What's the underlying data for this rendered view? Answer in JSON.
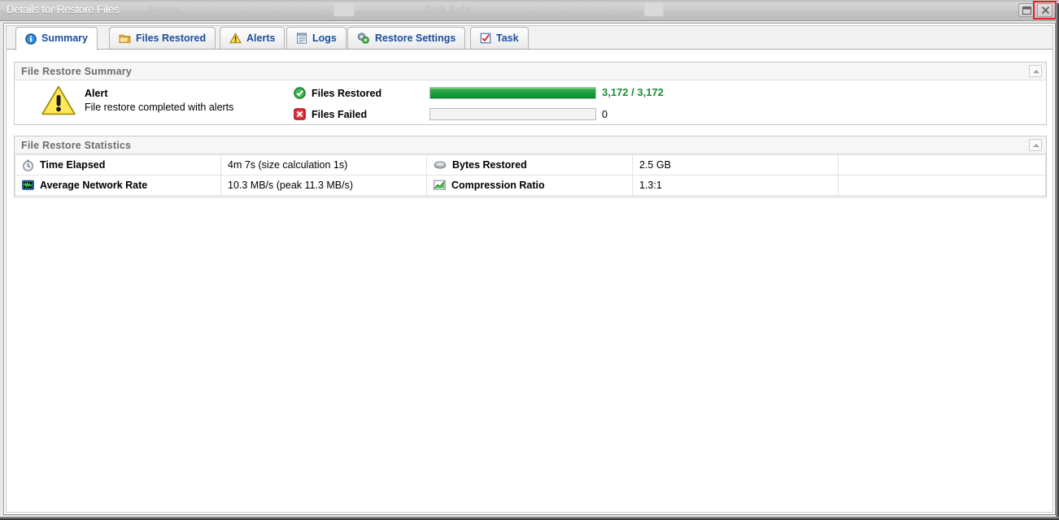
{
  "window": {
    "title": "Details for Restore Files",
    "background_text_1": "Server",
    "background_text_2": "Development Server Windows 2008",
    "background_text_3": "Disk Safe",
    "background_text_4": "Development Server Windows 2008",
    "restore_button_label": "",
    "close_button_label": "×",
    "highlight_color": "#ee1c25"
  },
  "tabs": [
    {
      "label": "Summary",
      "icon": "info-icon",
      "active": true
    },
    {
      "label": "Files Restored",
      "icon": "folder-icon",
      "active": false
    },
    {
      "label": "Alerts",
      "icon": "warning-triangle-icon",
      "active": false
    },
    {
      "label": "Logs",
      "icon": "document-lines-icon",
      "active": false
    },
    {
      "label": "Restore Settings",
      "icon": "gears-icon",
      "active": false
    },
    {
      "label": "Task",
      "icon": "checkbox-task-icon",
      "active": false
    }
  ],
  "summary_panel": {
    "title": "File Restore Summary",
    "collapse_icon": "chevron-up-icon",
    "alert": {
      "icon": "warning-triangle-icon",
      "title": "Alert",
      "message": "File restore completed with alerts"
    },
    "rows": [
      {
        "icon": "green-check-icon",
        "label": "Files Restored",
        "value": "3,172 / 3,172",
        "progress_percent": 100,
        "value_color": "#1e8c35"
      },
      {
        "icon": "red-x-icon",
        "label": "Files Failed",
        "value": "0",
        "progress_percent": 0,
        "value_color": "#000000"
      }
    ]
  },
  "statistics_panel": {
    "title": "File Restore Statistics",
    "collapse_icon": "chevron-up-icon",
    "rows": [
      {
        "left_icon": "stopwatch-icon",
        "left_label": "Time Elapsed",
        "left_value": "4m 7s (size calculation 1s)",
        "right_icon": "disk-icon",
        "right_label": "Bytes Restored",
        "right_value": "2.5 GB"
      },
      {
        "left_icon": "network-monitor-icon",
        "left_label": "Average Network Rate",
        "left_value": "10.3 MB/s (peak 11.3 MB/s)",
        "right_icon": "chart-icon",
        "right_label": "Compression Ratio",
        "right_value": "1.3:1"
      }
    ]
  }
}
